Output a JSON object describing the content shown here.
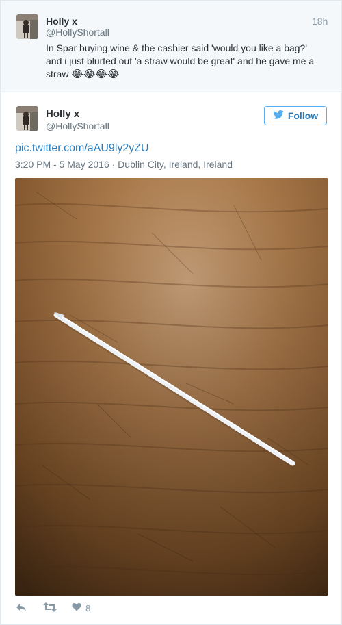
{
  "reply": {
    "name": "Holly x",
    "handle": "@HollyShortall",
    "time": "18h",
    "text_line1": "In Spar buying wine & the cashier said 'would you like a bag?'",
    "text_line2": "and i just blurted out 'a straw would be great' and he gave me a",
    "text_line3": "straw",
    "emojis": "😂😂😂😂"
  },
  "embed": {
    "name": "Holly x",
    "handle": "@HollyShortall",
    "follow_label": "Follow",
    "link": "pic.twitter.com/aAU9ly2yZU",
    "meta": "3:20 PM - 5 May 2016 · Dublin City, Ireland, Ireland",
    "like_count": "8"
  },
  "colors": {
    "twitter_blue": "#55acee",
    "link_blue": "#2b7bb9",
    "meta_gray": "#66757f"
  },
  "icons": [
    "reply-icon",
    "retweet-icon",
    "heart-icon",
    "twitter-bird-icon"
  ]
}
